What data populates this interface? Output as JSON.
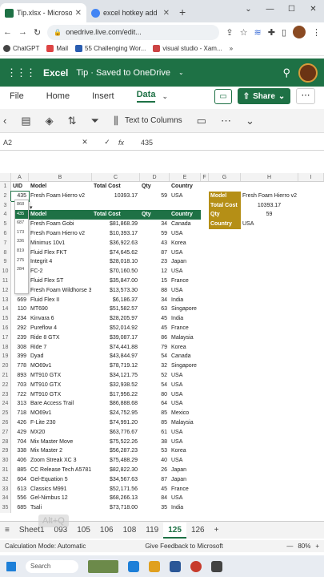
{
  "browser": {
    "tabs": [
      {
        "title": "Tip.xlsx - Microsoft",
        "color": "#1e7145"
      },
      {
        "title": "excel hotkey add",
        "color": "#4285f4"
      }
    ],
    "url": "onedrive.live.com/edit...",
    "bookmarks": [
      "ChatGPT",
      "Mail",
      "55 Challenging Wor...",
      "visual studio - Xam..."
    ]
  },
  "excel": {
    "app_name": "Excel",
    "doc_title": "Tip · Saved to OneDrive",
    "tabs": [
      "File",
      "Home",
      "Insert",
      "Data"
    ],
    "active_tab": "Data",
    "share_label": "Share",
    "text_to_columns": "Text to Columns",
    "name_box": "A2",
    "formula": "435"
  },
  "columns": [
    "A",
    "B",
    "C",
    "D",
    "E",
    "F",
    "G",
    "H",
    "I"
  ],
  "rows": [
    {
      "n": "1",
      "A": "UID",
      "B": "Model",
      "C": "Total Cost",
      "D": "Qty",
      "E": "Country",
      "F": "",
      "G": "",
      "H": "",
      "I": ""
    },
    {
      "n": "2",
      "A": "435",
      "B": "Fresh Foam Hierro v2",
      "C": "10393.17",
      "D": "59",
      "E": "USA",
      "F": "",
      "G": "Model",
      "H": "Fresh Foam Hierro v2",
      "I": ""
    },
    {
      "n": "3",
      "A": "",
      "B": "",
      "C": "",
      "D": "",
      "E": "",
      "F": "",
      "G": "Total Cost",
      "H": "10393.17",
      "I": ""
    },
    {
      "n": "4",
      "A": "",
      "B": "Model",
      "C": "Total Cost",
      "D": "Qty",
      "E": "Country",
      "F": "",
      "G": "Qty",
      "H": "59",
      "I": ""
    },
    {
      "n": "5",
      "A": "",
      "B": "Fresh Foam Gobi",
      "C": "$81,868.39",
      "D": "34",
      "E": "Canada",
      "F": "",
      "G": "Country",
      "H": "USA",
      "I": ""
    },
    {
      "n": "6",
      "A": "",
      "B": "Fresh Foam Hierro v2",
      "C": "$10,393.17",
      "D": "59",
      "E": "USA",
      "F": "",
      "G": "",
      "H": "",
      "I": ""
    },
    {
      "n": "7",
      "A": "",
      "B": "Minimus 10v1",
      "C": "$36,922.63",
      "D": "43",
      "E": "Korea",
      "F": "",
      "G": "",
      "H": "",
      "I": ""
    },
    {
      "n": "8",
      "A": "",
      "B": "Fluid Flex FKT",
      "C": "$74,645.62",
      "D": "87",
      "E": "USA",
      "F": "",
      "G": "",
      "H": "",
      "I": ""
    },
    {
      "n": "9",
      "A": "",
      "B": "Integrit 4",
      "C": "$28,018.10",
      "D": "23",
      "E": "Japan",
      "F": "",
      "G": "",
      "H": "",
      "I": ""
    },
    {
      "n": "10",
      "A": "",
      "B": "FC-2",
      "C": "$70,160.50",
      "D": "12",
      "E": "USA",
      "F": "",
      "G": "",
      "H": "",
      "I": ""
    },
    {
      "n": "11",
      "A": "",
      "B": "Fluid Flex ST",
      "C": "$35,847.00",
      "D": "15",
      "E": "France",
      "F": "",
      "G": "",
      "H": "",
      "I": ""
    },
    {
      "n": "12",
      "A": "",
      "B": "Fresh Foam Wildhorse 3",
      "C": "$13,573.30",
      "D": "88",
      "E": "USA",
      "F": "",
      "G": "",
      "H": "",
      "I": ""
    },
    {
      "n": "13",
      "A": "669",
      "B": "Fluid Flex II",
      "C": "$6,186.37",
      "D": "34",
      "E": "India",
      "F": "",
      "G": "",
      "H": "",
      "I": ""
    },
    {
      "n": "14",
      "A": "110",
      "B": "MT690",
      "C": "$51,582.57",
      "D": "63",
      "E": "Singapore",
      "F": "",
      "G": "",
      "H": "",
      "I": ""
    },
    {
      "n": "15",
      "A": "234",
      "B": "Kinvara 6",
      "C": "$28,205.97",
      "D": "45",
      "E": "India",
      "F": "",
      "G": "",
      "H": "",
      "I": ""
    },
    {
      "n": "16",
      "A": "292",
      "B": "Pureflow 4",
      "C": "$52,014.92",
      "D": "45",
      "E": "France",
      "F": "",
      "G": "",
      "H": "",
      "I": ""
    },
    {
      "n": "17",
      "A": "239",
      "B": "Ride 8 GTX",
      "C": "$39,087.17",
      "D": "86",
      "E": "Malaysia",
      "F": "",
      "G": "",
      "H": "",
      "I": ""
    },
    {
      "n": "18",
      "A": "308",
      "B": "Ride 7",
      "C": "$74,441.88",
      "D": "79",
      "E": "Korea",
      "F": "",
      "G": "",
      "H": "",
      "I": ""
    },
    {
      "n": "19",
      "A": "399",
      "B": "Dyad",
      "C": "$43,844.97",
      "D": "54",
      "E": "Canada",
      "F": "",
      "G": "",
      "H": "",
      "I": ""
    },
    {
      "n": "20",
      "A": "778",
      "B": "MO69v1",
      "C": "$78,719.12",
      "D": "32",
      "E": "Singapore",
      "F": "",
      "G": "",
      "H": "",
      "I": ""
    },
    {
      "n": "21",
      "A": "893",
      "B": "MT910 GTX",
      "C": "$34,121.75",
      "D": "52",
      "E": "USA",
      "F": "",
      "G": "",
      "H": "",
      "I": ""
    },
    {
      "n": "22",
      "A": "703",
      "B": "MT910 GTX",
      "C": "$32,938.52",
      "D": "54",
      "E": "USA",
      "F": "",
      "G": "",
      "H": "",
      "I": ""
    },
    {
      "n": "23",
      "A": "722",
      "B": "MT910 GTX",
      "C": "$17,956.22",
      "D": "80",
      "E": "USA",
      "F": "",
      "G": "",
      "H": "",
      "I": ""
    },
    {
      "n": "24",
      "A": "313",
      "B": "Bare Access Trail",
      "C": "$86,888.68",
      "D": "64",
      "E": "USA",
      "F": "",
      "G": "",
      "H": "",
      "I": ""
    },
    {
      "n": "25",
      "A": "718",
      "B": "MO69v1",
      "C": "$24,752.95",
      "D": "85",
      "E": "Mexico",
      "F": "",
      "G": "",
      "H": "",
      "I": ""
    },
    {
      "n": "26",
      "A": "426",
      "B": "F-Lite 230",
      "C": "$74,991.20",
      "D": "85",
      "E": "Malaysia",
      "F": "",
      "G": "",
      "H": "",
      "I": ""
    },
    {
      "n": "27",
      "A": "429",
      "B": "MX20",
      "C": "$63,776.67",
      "D": "61",
      "E": "USA",
      "F": "",
      "G": "",
      "H": "",
      "I": ""
    },
    {
      "n": "28",
      "A": "704",
      "B": "Mix Master Move",
      "C": "$75,522.26",
      "D": "38",
      "E": "USA",
      "F": "",
      "G": "",
      "H": "",
      "I": ""
    },
    {
      "n": "29",
      "A": "338",
      "B": "Mix Master 2",
      "C": "$56,287.23",
      "D": "53",
      "E": "Korea",
      "F": "",
      "G": "",
      "H": "",
      "I": ""
    },
    {
      "n": "30",
      "A": "406",
      "B": "Zoom Streak XC 3",
      "C": "$75,488.29",
      "D": "40",
      "E": "USA",
      "F": "",
      "G": "",
      "H": "",
      "I": ""
    },
    {
      "n": "31",
      "A": "885",
      "B": "CC Release Tech A5781M",
      "C": "$82,822.30",
      "D": "26",
      "E": "Japan",
      "F": "",
      "G": "",
      "H": "",
      "I": ""
    },
    {
      "n": "32",
      "A": "604",
      "B": "Gel-Equation 5",
      "C": "$34,567.63",
      "D": "87",
      "E": "Japan",
      "F": "",
      "G": "",
      "H": "",
      "I": ""
    },
    {
      "n": "33",
      "A": "613",
      "B": "Classics M991",
      "C": "$52,171.56",
      "D": "45",
      "E": "France",
      "F": "",
      "G": "",
      "H": "",
      "I": ""
    },
    {
      "n": "34",
      "A": "556",
      "B": "Gel-Nimbus 12",
      "C": "$68,266.13",
      "D": "84",
      "E": "USA",
      "F": "",
      "G": "",
      "H": "",
      "I": ""
    },
    {
      "n": "35",
      "A": "685",
      "B": "Tsali",
      "C": "$73,718.00",
      "D": "35",
      "E": "India",
      "F": "",
      "G": "",
      "H": "",
      "I": ""
    }
  ],
  "dropdown_values": [
    "868",
    "435",
    "687",
    "173",
    "336",
    "819",
    "275",
    "284"
  ],
  "dropdown_selected_index": 1,
  "sheet_tabs": [
    "Sheet1",
    "093",
    "105",
    "106",
    "108",
    "119",
    "125",
    "126"
  ],
  "active_sheet": "125",
  "watermark": "Alt+Q",
  "status": {
    "calc_mode": "Calculation Mode: Automatic",
    "feedback": "Give Feedback to Microsoft",
    "zoom": "80%"
  },
  "taskbar": {
    "search": "Search"
  },
  "colors": {
    "excel_green": "#1e7145",
    "gold": "#b58f16"
  }
}
